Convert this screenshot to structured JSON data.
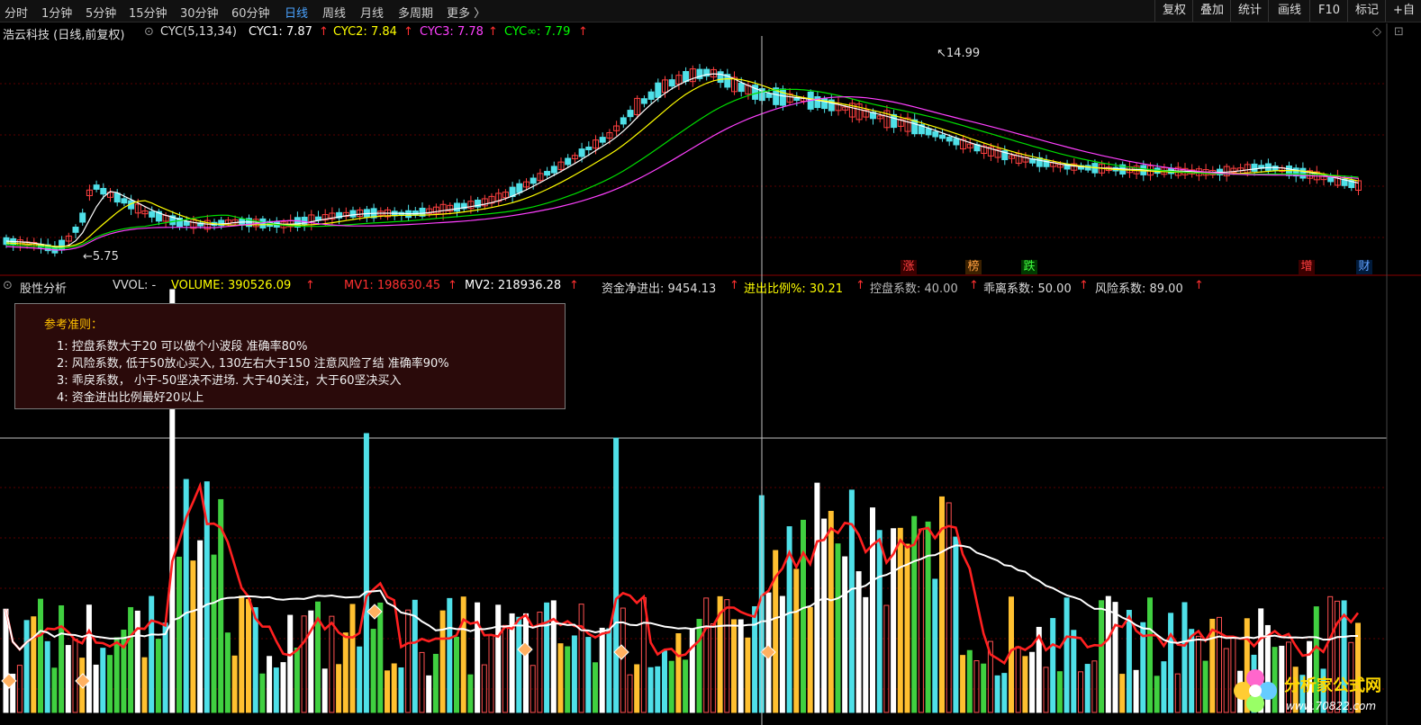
{
  "toolbar": {
    "periods": [
      "分时",
      "1分钟",
      "5分钟",
      "15分钟",
      "30分钟",
      "60分钟",
      "日线",
      "周线",
      "月线",
      "多周期",
      "更多 〉"
    ],
    "active_period": "日线",
    "right_tools": [
      "复权",
      "叠加",
      "统计",
      "画线",
      "F10",
      "标记",
      "+自"
    ]
  },
  "main_header": {
    "stock": "浩云科技 (日线,前复权)",
    "indicator": "CYC(5,13,34)",
    "cyc1": "CYC1: 7.87",
    "cyc2": "CYC2: 7.84",
    "cyc3": "CYC3: 7.78",
    "cycinf": "CYC∞: 7.79",
    "up_arrow": "↑",
    "colors": {
      "cyc1": "#ffffff",
      "cyc2": "#ffff00",
      "cyc3": "#ff40ff",
      "cycinf": "#00ff00"
    }
  },
  "price_labels": {
    "high": "14.99",
    "low": "5.75"
  },
  "event_marks": [
    {
      "text": "涨",
      "color": "#ff4040"
    },
    {
      "text": "榜",
      "color": "#ffa040"
    },
    {
      "text": "跌",
      "color": "#40ff40"
    },
    {
      "text": "增",
      "color": "#ff4040"
    },
    {
      "text": "财",
      "color": "#60a0ff"
    }
  ],
  "sub_header": {
    "title": "股性分析",
    "vvol": "VVOL: -",
    "volume": "VOLUME: 390526.09",
    "mv1": "MV1: 198630.45",
    "mv2": "MV2: 218936.28",
    "net_flow": "资金净进出: 9454.13",
    "flow_ratio": "进出比例%: 30.21",
    "control": "控盘系数: 40.00",
    "deviation": "乖离系数: 50.00",
    "risk": "风险系数: 89.00",
    "up_arrow": "↑"
  },
  "reference": {
    "title": "参考准则：",
    "lines": [
      "1:  控盘系数大于20 可以做个小波段  准确率80%",
      "2:  风险系数, 低于50放心买入, 130左右大于150 注意风险了结  准确率90%",
      "3:  乖戾系数，  小于-50坚决不进场. 大于40关注，大于60坚决买入",
      "4:  资金进出比例最好20以上"
    ]
  },
  "watermark": {
    "title": "分析家公式网",
    "url": "www.70822.com"
  }
}
